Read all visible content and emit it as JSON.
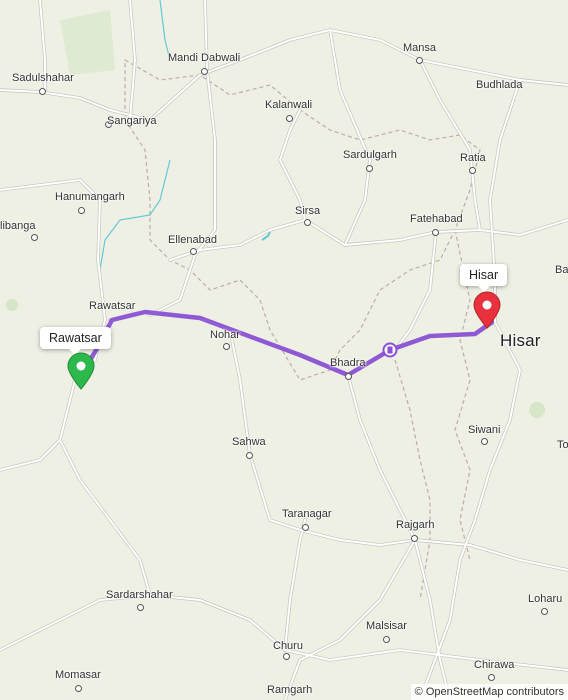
{
  "map": {
    "places": [
      {
        "name": "Sadulshahar",
        "kind": "town"
      },
      {
        "name": "Mandi Dabwali",
        "kind": "town"
      },
      {
        "name": "Mansa",
        "kind": "town"
      },
      {
        "name": "Budhlada",
        "kind": "town"
      },
      {
        "name": "Sangariya",
        "kind": "town"
      },
      {
        "name": "Kalanwali",
        "kind": "town"
      },
      {
        "name": "Sardulgarh",
        "kind": "town"
      },
      {
        "name": "Ratia",
        "kind": "town"
      },
      {
        "name": "Hanumangarh",
        "kind": "town"
      },
      {
        "name": "Sirsa",
        "kind": "town"
      },
      {
        "name": "Fatehabad",
        "kind": "town"
      },
      {
        "name": "Pilibanga",
        "kind": "town",
        "visible_text": "libanga"
      },
      {
        "name": "Ellenabad",
        "kind": "town"
      },
      {
        "name": "Rawatsar",
        "kind": "town"
      },
      {
        "name": "Nohar",
        "kind": "town"
      },
      {
        "name": "Bhadra",
        "kind": "town"
      },
      {
        "name": "Hisar",
        "kind": "city"
      },
      {
        "name": "Siwani",
        "kind": "town"
      },
      {
        "name": "Sahwa",
        "kind": "town"
      },
      {
        "name": "Taranagar",
        "kind": "town"
      },
      {
        "name": "Rajgarh",
        "kind": "town"
      },
      {
        "name": "Sardarshahar",
        "kind": "town"
      },
      {
        "name": "Loharu",
        "kind": "town"
      },
      {
        "name": "Malsisar",
        "kind": "town"
      },
      {
        "name": "Churu",
        "kind": "town"
      },
      {
        "name": "Chirawa",
        "kind": "town"
      },
      {
        "name": "Momasar",
        "kind": "town"
      },
      {
        "name": "Ramgarh",
        "kind": "town"
      },
      {
        "name": "Ba",
        "kind": "edge-label"
      },
      {
        "name": "To",
        "kind": "edge-label"
      }
    ],
    "route": {
      "start": {
        "label": "Rawatsar",
        "pin_color": "#2db84b"
      },
      "end": {
        "label": "Hisar",
        "pin_color": "#e8313c"
      },
      "line_color": "#8a4fd6",
      "toll_icon": "toll-booth-icon"
    },
    "attribution": "© OpenStreetMap contributors",
    "colors": {
      "land": "#eef0e4",
      "highway": "#ffffff",
      "road_casing": "#c8c8c0",
      "border": "#b8a8a8",
      "water": "#64c8d8"
    }
  }
}
